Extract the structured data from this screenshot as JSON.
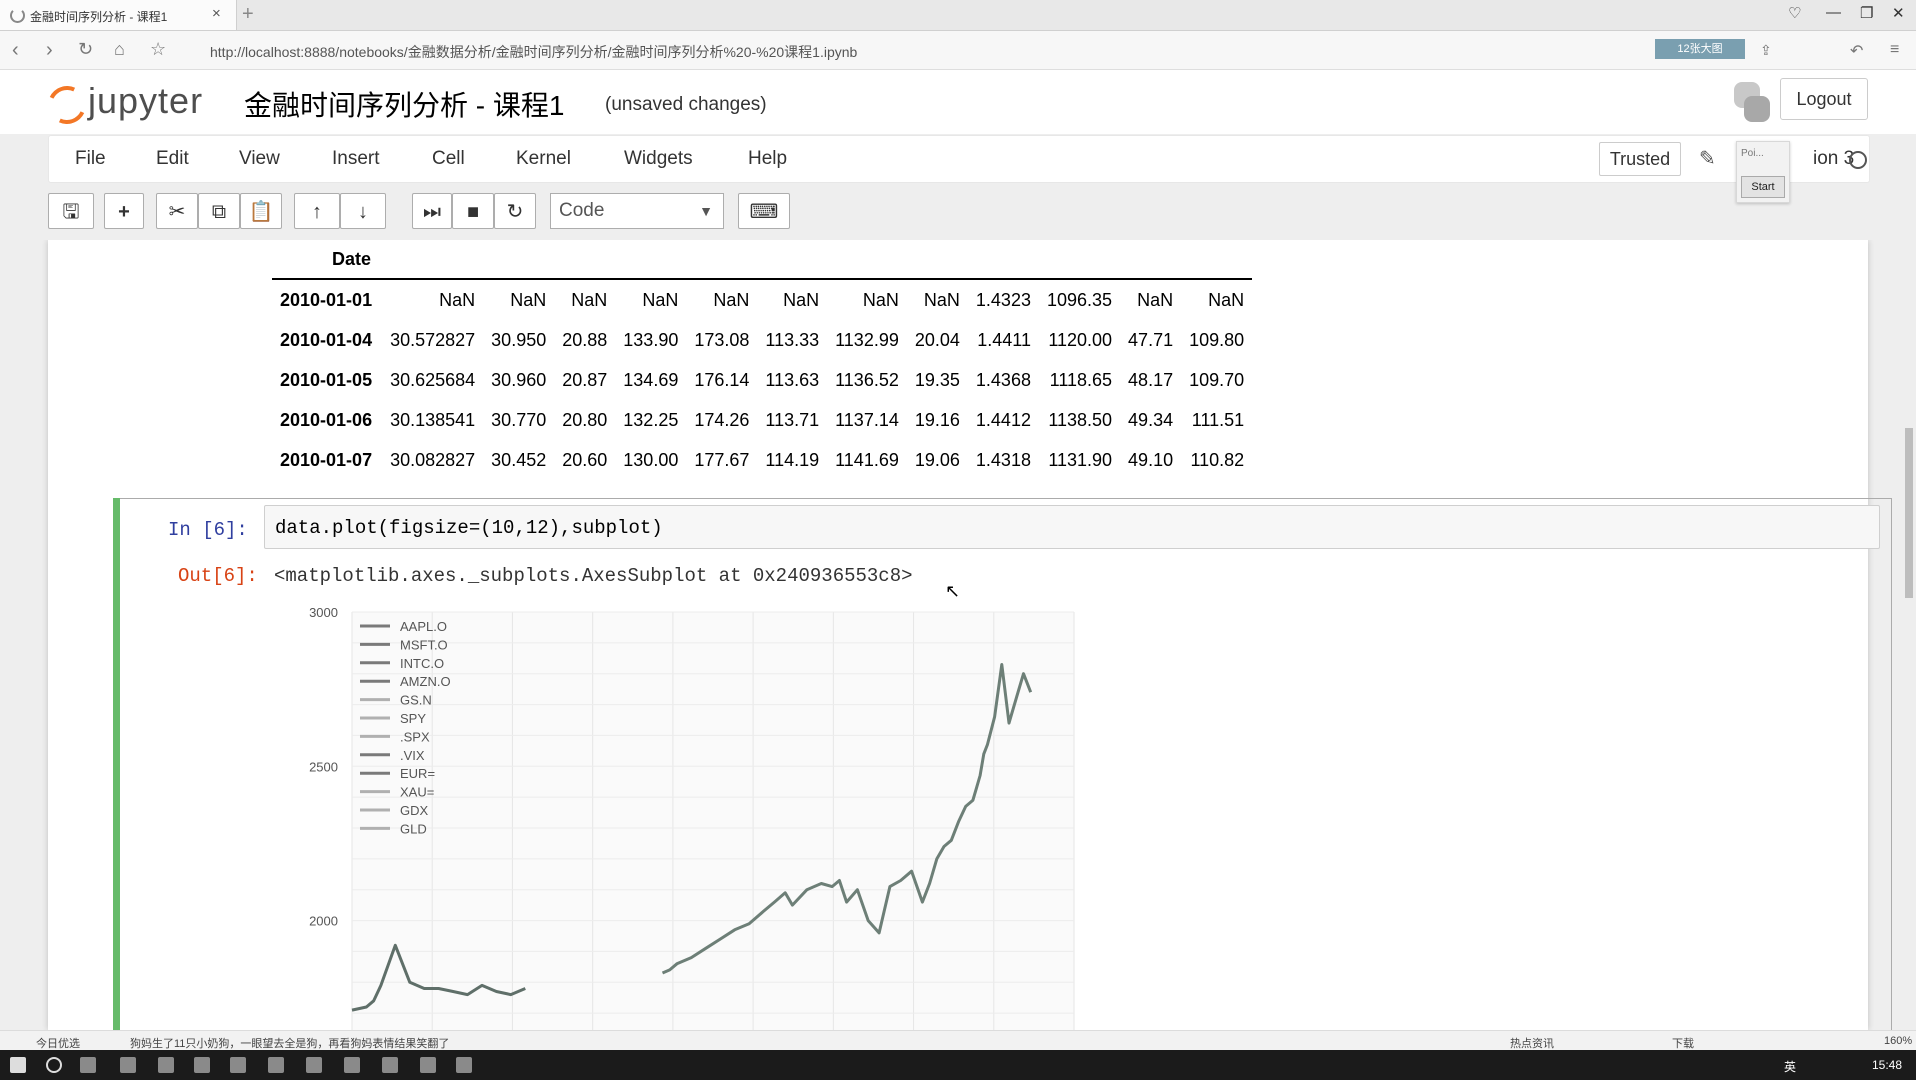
{
  "browser": {
    "tab_title": "金融时间序列分析 - 课程1",
    "url": "http://localhost:8888/notebooks/金融数据分析/金融时间序列分析/金融时间序列分析%20-%20课程1.ipynb",
    "extension_badge": "12张大图"
  },
  "jupyter": {
    "logo_text": "jupyter",
    "notebook_title": "金融时间序列分析 - 课程1",
    "save_status": "(unsaved changes)",
    "logout_label": "Logout",
    "menu": [
      "File",
      "Edit",
      "View",
      "Insert",
      "Cell",
      "Kernel",
      "Widgets",
      "Help"
    ],
    "trusted_label": "Trusted",
    "kernel_name": "ion 3",
    "popup_label": "Poi...",
    "popup_button": "Start",
    "cell_type": "Code"
  },
  "dataframe": {
    "index_name": "Date",
    "rows": [
      {
        "date": "2010-01-01",
        "values": [
          "NaN",
          "NaN",
          "NaN",
          "NaN",
          "NaN",
          "NaN",
          "NaN",
          "NaN",
          "1.4323",
          "1096.35",
          "NaN",
          "NaN"
        ]
      },
      {
        "date": "2010-01-04",
        "values": [
          "30.572827",
          "30.950",
          "20.88",
          "133.90",
          "173.08",
          "113.33",
          "1132.99",
          "20.04",
          "1.4411",
          "1120.00",
          "47.71",
          "109.80"
        ]
      },
      {
        "date": "2010-01-05",
        "values": [
          "30.625684",
          "30.960",
          "20.87",
          "134.69",
          "176.14",
          "113.63",
          "1136.52",
          "19.35",
          "1.4368",
          "1118.65",
          "48.17",
          "109.70"
        ]
      },
      {
        "date": "2010-01-06",
        "values": [
          "30.138541",
          "30.770",
          "20.80",
          "132.25",
          "174.26",
          "113.71",
          "1137.14",
          "19.16",
          "1.4412",
          "1138.50",
          "49.34",
          "111.51"
        ]
      },
      {
        "date": "2010-01-07",
        "values": [
          "30.082827",
          "30.452",
          "20.60",
          "130.00",
          "177.67",
          "114.19",
          "1141.69",
          "19.06",
          "1.4318",
          "1131.90",
          "49.10",
          "110.82"
        ]
      }
    ]
  },
  "cell": {
    "in_prompt": "In  [6]:",
    "code": "data.plot(figsize=(10,12),subplot)",
    "out_prompt": "Out[6]:",
    "output_text": "<matplotlib.axes._subplots.AxesSubplot at 0x240936553c8>"
  },
  "chart_data": {
    "type": "line",
    "ylim": [
      1600,
      3000
    ],
    "yticks": [
      3000,
      2500,
      2000
    ],
    "grid": true,
    "legend_position": "top-left",
    "legend": [
      "AAPL.O",
      "MSFT.O",
      "INTC.O",
      "AMZN.O",
      "GS.N",
      "SPY",
      ".SPX",
      ".VIX",
      "EUR=",
      "XAU=",
      "GDX",
      "GLD"
    ],
    "series": [
      {
        "name": "AMZN.O",
        "x": [
          0.43,
          0.44,
          0.45,
          0.47,
          0.49,
          0.51,
          0.53,
          0.55,
          0.57,
          0.585,
          0.6,
          0.61,
          0.63,
          0.65,
          0.665,
          0.675,
          0.685,
          0.7,
          0.715,
          0.73,
          0.745,
          0.76,
          0.775,
          0.79,
          0.8,
          0.81,
          0.82,
          0.83,
          0.84,
          0.85,
          0.86,
          0.865,
          0.87,
          0.875,
          0.88,
          0.89,
          0.9,
          0.91,
          0.92,
          0.93,
          0.94
        ],
        "y": [
          1830,
          1840,
          1860,
          1880,
          1910,
          1940,
          1970,
          1990,
          2030,
          2060,
          2090,
          2050,
          2100,
          2120,
          2110,
          2130,
          2060,
          2100,
          2000,
          1960,
          2110,
          2130,
          2160,
          2060,
          2120,
          2200,
          2240,
          2260,
          2320,
          2370,
          2390,
          2430,
          2470,
          2540,
          2570,
          2660,
          2830,
          2640,
          2720,
          2800,
          2740
        ]
      },
      {
        "name": "GS.N",
        "x": [
          0.0,
          0.02,
          0.03,
          0.04,
          0.06,
          0.08,
          0.1,
          0.12,
          0.14,
          0.16,
          0.18,
          0.2,
          0.22,
          0.24
        ],
        "y": [
          1710,
          1720,
          1740,
          1790,
          1920,
          1800,
          1780,
          1780,
          1770,
          1760,
          1790,
          1770,
          1760,
          1780
        ]
      }
    ]
  },
  "statusbar": {
    "left1": "今日优选",
    "left2": "狗妈生了11只小奶狗，一眼望去全是狗，再看狗妈表情结果笑翻了",
    "right1": "热点资讯",
    "right2": "下载",
    "zoom": "160%"
  },
  "taskbar": {
    "lang": "英",
    "clock": "15:48"
  }
}
